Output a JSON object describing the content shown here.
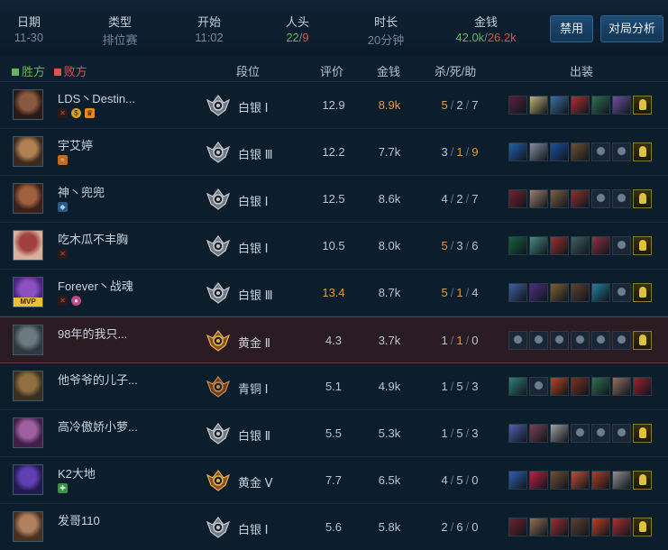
{
  "topbar": {
    "date": {
      "label": "日期",
      "value": "11-30"
    },
    "type": {
      "label": "类型",
      "value": "排位赛"
    },
    "start": {
      "label": "开始",
      "value": "11:02"
    },
    "kills": {
      "label": "人头",
      "left": "22",
      "sep": "/",
      "right": "9"
    },
    "duration": {
      "label": "时长",
      "value": "20分钟"
    },
    "gold": {
      "label": "金钱",
      "left": "42.0k",
      "sep": "/",
      "right": "26.2k"
    },
    "ban_button": "禁用",
    "analysis_button": "对局分析"
  },
  "header": {
    "win_label": "胜方",
    "lose_label": "败方",
    "rank": "段位",
    "score": "评价",
    "gold": "金钱",
    "kda": "杀/死/助",
    "items": "出装"
  },
  "colors": {
    "win": "#5fb562",
    "lose": "#d9534f",
    "accent": "#e09a40"
  },
  "players": [
    {
      "name": "LDS丶Destin...",
      "tags": [
        "sword",
        "gold",
        "crown"
      ],
      "rank": "白银 Ⅰ",
      "rank_tier": "silver",
      "score": "12.9",
      "score_hi": false,
      "gold": "8.9k",
      "gold_hi": true,
      "k": "5",
      "d": "2",
      "a": "7",
      "hi": "k",
      "mvp": false,
      "avatar": [
        "#2a1a14",
        "#8a5a40"
      ],
      "items": [
        "#5a2040",
        "#c0b070",
        "#3a70a0",
        "#b03030",
        "#2e7050",
        "#7050a0",
        "trinket"
      ]
    },
    {
      "name": "宇艾婷",
      "tags": [
        "orange"
      ],
      "rank": "白银 Ⅲ",
      "rank_tier": "silver",
      "score": "12.2",
      "score_hi": false,
      "gold": "7.7k",
      "gold_hi": false,
      "k": "3",
      "d": "1",
      "a": "9",
      "hi": "da",
      "mvp": false,
      "avatar": [
        "#3a2a20",
        "#b08050"
      ],
      "items": [
        "#2060b0",
        "#8090a0",
        "#1a50a0",
        "#705030",
        "empty",
        "empty",
        "trinket"
      ]
    },
    {
      "name": "神丶兜兜",
      "tags": [
        "blue"
      ],
      "rank": "白银 Ⅰ",
      "rank_tier": "silver",
      "score": "12.5",
      "score_hi": false,
      "gold": "8.6k",
      "gold_hi": false,
      "k": "4",
      "d": "2",
      "a": "7",
      "hi": "",
      "mvp": false,
      "avatar": [
        "#3a2018",
        "#a06040"
      ],
      "items": [
        "#7a2030",
        "#a08070",
        "#806040",
        "#903030",
        "empty",
        "empty",
        "trinket"
      ]
    },
    {
      "name": "吃木瓜不丰胸",
      "tags": [
        "sword"
      ],
      "rank": "白银 Ⅰ",
      "rank_tier": "silver",
      "score": "10.5",
      "score_hi": false,
      "gold": "8.0k",
      "gold_hi": false,
      "k": "5",
      "d": "3",
      "a": "6",
      "hi": "k",
      "mvp": false,
      "avatar": [
        "#d8b0a0",
        "#a04040"
      ],
      "items": [
        "#1a6040",
        "#4a8a80",
        "#a03030",
        "#406060",
        "#903040",
        "empty",
        "trinket"
      ]
    },
    {
      "name": "Forever丶战魂",
      "tags": [
        "sword",
        "pink"
      ],
      "rank": "白银 Ⅲ",
      "rank_tier": "silver",
      "score": "13.4",
      "score_hi": true,
      "gold": "8.7k",
      "gold_hi": false,
      "k": "5",
      "d": "1",
      "a": "4",
      "hi": "kd",
      "mvp": true,
      "mvp_label": "MVP",
      "avatar": [
        "#4a2080",
        "#8a50c0"
      ],
      "items": [
        "#4060a0",
        "#503080",
        "#806030",
        "#604030",
        "#2080a0",
        "empty",
        "trinket"
      ]
    },
    {
      "name": "98年的我只...",
      "tags": [],
      "rank": "黄金 Ⅱ",
      "rank_tier": "gold",
      "score": "4.3",
      "score_hi": false,
      "gold": "3.7k",
      "gold_hi": false,
      "k": "1",
      "d": "1",
      "a": "0",
      "hi": "d",
      "mvp": false,
      "avatar": [
        "#303840",
        "#6a7a80"
      ],
      "items": [
        "empty",
        "empty",
        "empty",
        "empty",
        "empty",
        "empty",
        "trinket"
      ]
    },
    {
      "name": "他爷爷的儿子...",
      "tags": [],
      "rank": "青铜 Ⅰ",
      "rank_tier": "bronze",
      "score": "5.1",
      "score_hi": false,
      "gold": "4.9k",
      "gold_hi": false,
      "k": "1",
      "d": "5",
      "a": "3",
      "hi": "",
      "mvp": false,
      "avatar": [
        "#3a3020",
        "#907040"
      ],
      "items": [
        "#30807a",
        "empty",
        "#c04020",
        "#803020",
        "#307050",
        "#907060",
        "#a02030"
      ]
    },
    {
      "name": "高冷傲娇小萝...",
      "tags": [],
      "rank": "白银 Ⅱ",
      "rank_tier": "silver",
      "score": "5.5",
      "score_hi": false,
      "gold": "5.3k",
      "gold_hi": false,
      "k": "1",
      "d": "5",
      "a": "3",
      "hi": "",
      "mvp": false,
      "avatar": [
        "#40204a",
        "#a060a0"
      ],
      "items": [
        "#5060b0",
        "#7a4050",
        "#a0a0a0",
        "empty",
        "empty",
        "empty",
        "trinket"
      ]
    },
    {
      "name": "K2大地",
      "tags": [
        "green"
      ],
      "rank": "黄金 Ⅴ",
      "rank_tier": "gold",
      "score": "7.7",
      "score_hi": false,
      "gold": "6.5k",
      "gold_hi": false,
      "k": "4",
      "d": "5",
      "a": "0",
      "hi": "",
      "mvp": false,
      "avatar": [
        "#201a50",
        "#6040b0"
      ],
      "items": [
        "#3060b0",
        "#c02040",
        "#705030",
        "#c05030",
        "#b04020",
        "#909090",
        "trinket"
      ]
    },
    {
      "name": "发哥110",
      "tags": [],
      "rank": "白银 Ⅰ",
      "rank_tier": "silver",
      "score": "5.6",
      "score_hi": false,
      "gold": "5.8k",
      "gold_hi": false,
      "k": "2",
      "d": "6",
      "a": "0",
      "hi": "",
      "mvp": false,
      "avatar": [
        "#4a3020",
        "#b08060"
      ],
      "items": [
        "#702030",
        "#907050",
        "#a03030",
        "#604030",
        "#c04020",
        "#b03030",
        "trinket"
      ]
    }
  ]
}
